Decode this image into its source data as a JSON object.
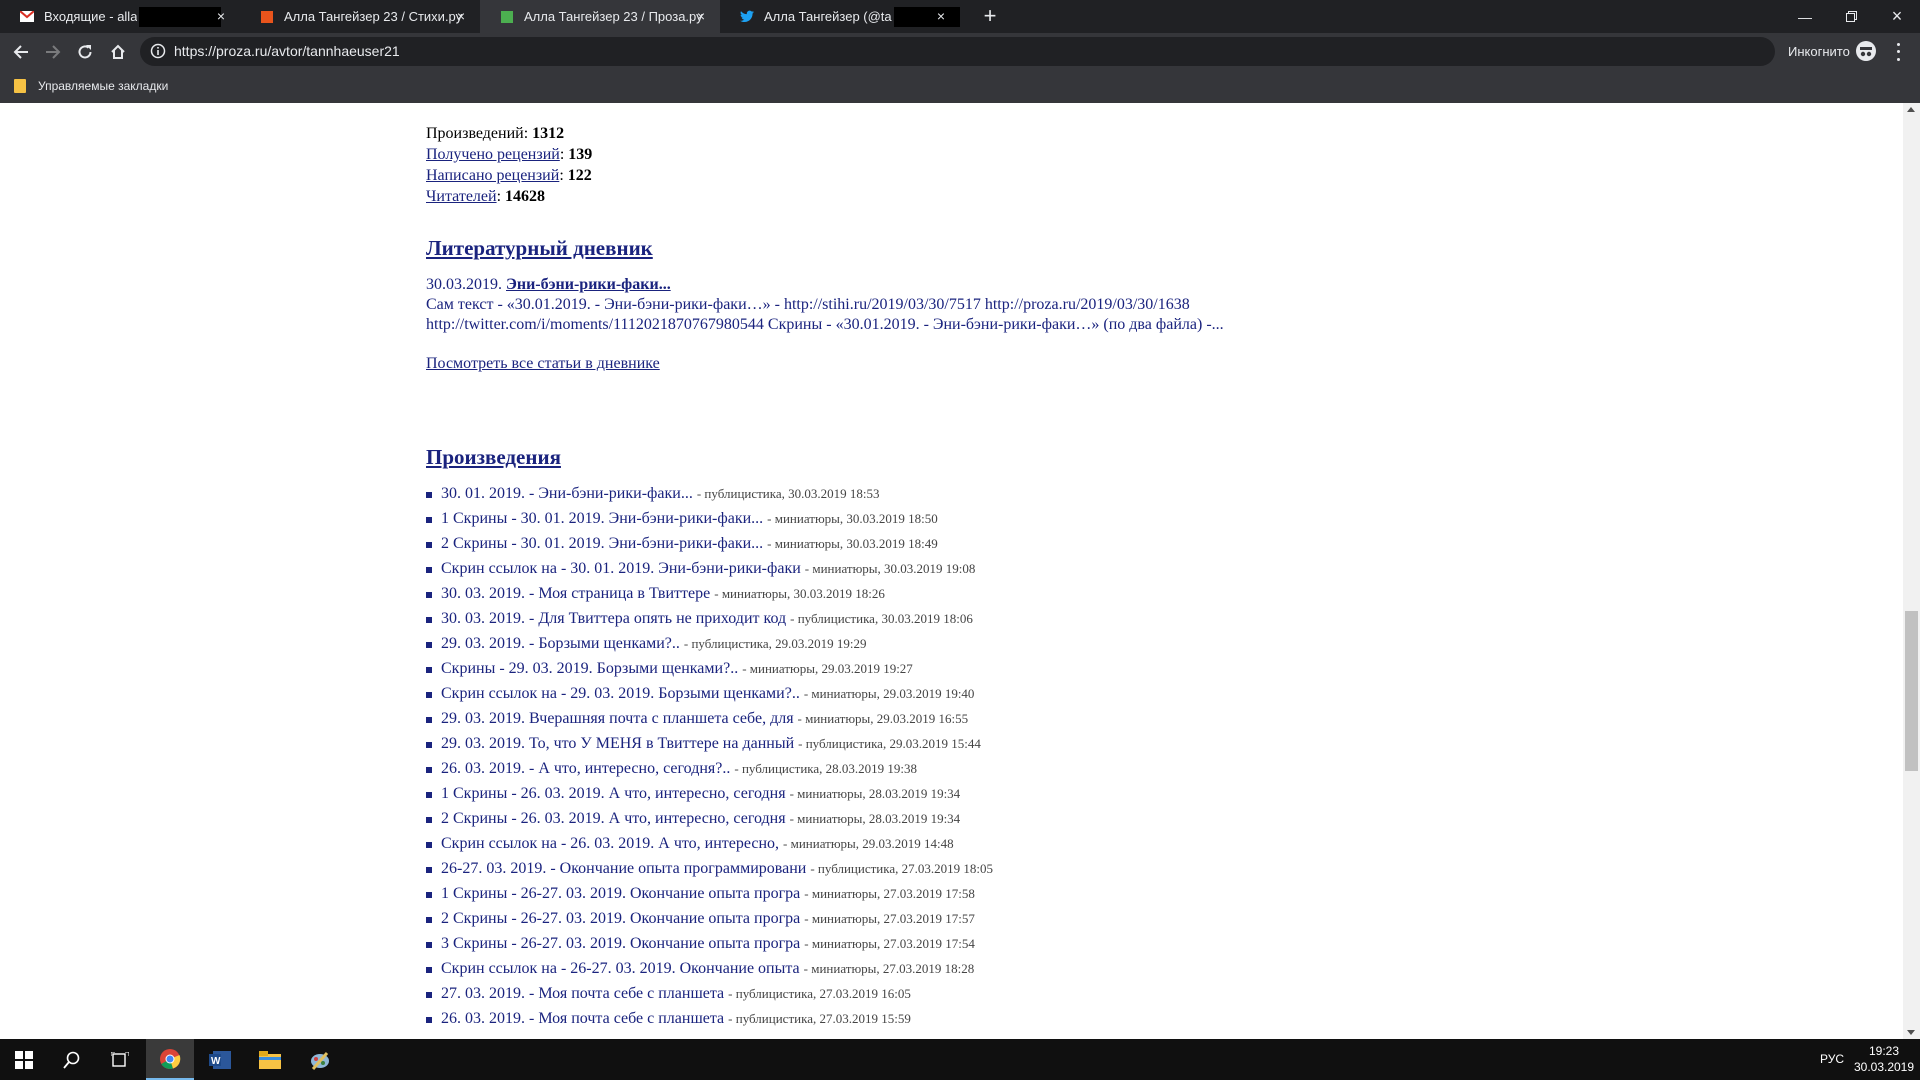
{
  "browser": {
    "tabs": [
      {
        "title": "Входящие - alla",
        "icon": "gmail-icon",
        "active": false
      },
      {
        "title": "Алла Тангейзер 23 / Стихи.ру",
        "icon": "stihi-icon",
        "active": false
      },
      {
        "title": "Алла Тангейзер 23 / Проза.ру",
        "icon": "proza-icon",
        "active": true
      },
      {
        "title": "Алла Тангейзер (@ta",
        "icon": "twitter-icon",
        "active": false
      }
    ],
    "url": "https://proza.ru/avtor/tannhaeuser21",
    "incognito_label": "Инкогнито",
    "bookmark_folder": "Управляемые закладки"
  },
  "stats": {
    "works_label": "Произведений",
    "works_value": "1312",
    "reviews_received_label": "Получено рецензий",
    "reviews_received_value": "139",
    "reviews_written_label": "Написано рецензий",
    "reviews_written_value": "122",
    "readers_label": "Читателей",
    "readers_value": "14628"
  },
  "diary": {
    "heading": "Литературный дневник",
    "date": "30.03.2019.",
    "title": "Эни-бэни-рики-факи...",
    "line1": "Сам текст - «30.01.2019. - Эни-бэни-рики-факи…» - http://stihi.ru/2019/03/30/7517 http://proza.ru/2019/03/30/1638",
    "line2": "http://twitter.com/i/moments/1112021870767980544 Скрины - «30.01.2019. - Эни-бэни-рики-факи…» (по два файла) -...",
    "view_all": "Посмотреть все статьи в дневнике"
  },
  "works": {
    "heading": "Произведения",
    "items": [
      {
        "title": "30. 01. 2019. - Эни-бэни-рики-факи...",
        "meta": "- публицистика, 30.03.2019 18:53"
      },
      {
        "title": "1 Скрины - 30. 01. 2019. Эни-бэни-рики-факи...",
        "meta": "- миниатюры, 30.03.2019 18:50"
      },
      {
        "title": "2 Скрины - 30. 01. 2019. Эни-бэни-рики-факи...",
        "meta": "- миниатюры, 30.03.2019 18:49"
      },
      {
        "title": "Скрин ссылок на - 30. 01. 2019. Эни-бэни-рики-факи",
        "meta": "- миниатюры, 30.03.2019 19:08"
      },
      {
        "title": "30. 03. 2019. - Моя страница в Твиттере",
        "meta": "- миниатюры, 30.03.2019 18:26"
      },
      {
        "title": "30. 03. 2019. - Для Твиттера опять не приходит код",
        "meta": "- публицистика, 30.03.2019 18:06"
      },
      {
        "title": "29. 03. 2019. - Борзыми щенками?..",
        "meta": "- публицистика, 29.03.2019 19:29"
      },
      {
        "title": "Скрины - 29. 03. 2019. Борзыми щенками?..",
        "meta": "- миниатюры, 29.03.2019 19:27"
      },
      {
        "title": "Скрин ссылок на - 29. 03. 2019. Борзыми щенками?..",
        "meta": "- миниатюры, 29.03.2019 19:40"
      },
      {
        "title": "29. 03. 2019. Вчерашняя почта с планшета себе, для",
        "meta": "- миниатюры, 29.03.2019 16:55"
      },
      {
        "title": "29. 03. 2019. То, что У МЕНЯ в Твиттере на данный",
        "meta": "- публицистика, 29.03.2019 15:44"
      },
      {
        "title": "26. 03. 2019. - А что, интересно, сегодня?..",
        "meta": "- публицистика, 28.03.2019 19:38"
      },
      {
        "title": "1 Скрины - 26. 03. 2019. А что, интересно, сегодня",
        "meta": "- миниатюры, 28.03.2019 19:34"
      },
      {
        "title": "2 Скрины - 26. 03. 2019. А что, интересно, сегодня",
        "meta": "- миниатюры, 28.03.2019 19:34"
      },
      {
        "title": "Скрин ссылок на - 26. 03. 2019. А что, интересно,",
        "meta": "- миниатюры, 29.03.2019 14:48"
      },
      {
        "title": "26-27. 03. 2019. - Окончание опыта программировани",
        "meta": "- публицистика, 27.03.2019 18:05"
      },
      {
        "title": "1 Скрины - 26-27. 03. 2019. Окончание опыта програ",
        "meta": "- миниатюры, 27.03.2019 17:58"
      },
      {
        "title": "2 Скрины - 26-27. 03. 2019. Окончание опыта програ",
        "meta": "- миниатюры, 27.03.2019 17:57"
      },
      {
        "title": "3 Скрины - 26-27. 03. 2019. Окончание опыта програ",
        "meta": "- миниатюры, 27.03.2019 17:54"
      },
      {
        "title": "Скрин ссылок на - 26-27. 03. 2019. Окончание опыта",
        "meta": "- миниатюры, 27.03.2019 18:28"
      },
      {
        "title": "27. 03. 2019. - Моя почта себе с планшета",
        "meta": "- публицистика, 27.03.2019 16:05"
      },
      {
        "title": "26. 03. 2019. - Моя почта себе с планшета",
        "meta": "- публицистика, 27.03.2019 15:59"
      }
    ]
  },
  "taskbar": {
    "language": "РУС",
    "time": "19:23",
    "date": "30.03.2019"
  },
  "colors": {
    "link": "#1a237e",
    "chrome_dark": "#202124",
    "chrome_toolbar": "#35363a"
  }
}
